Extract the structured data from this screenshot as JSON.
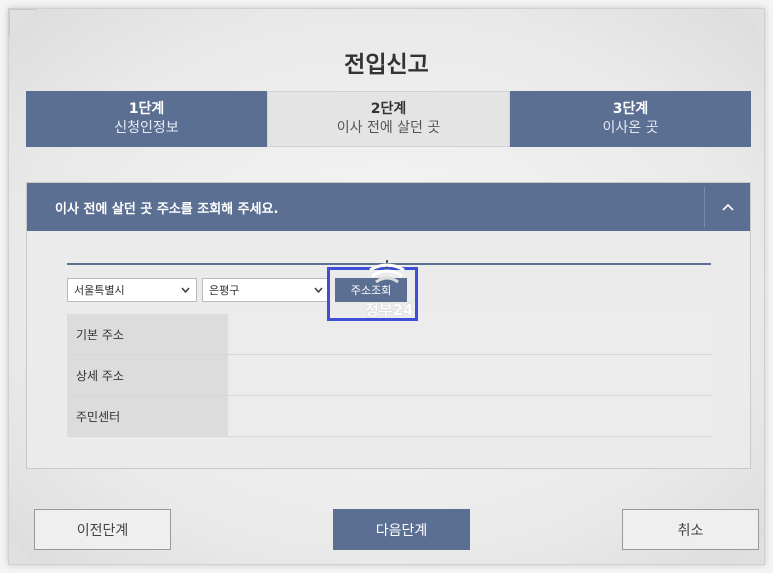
{
  "title": "전입신고",
  "steps": [
    {
      "num": "1단계",
      "label": "신청인정보"
    },
    {
      "num": "2단계",
      "label": "이사 전에 살던 곳"
    },
    {
      "num": "3단계",
      "label": "이사온 곳"
    }
  ],
  "panel": {
    "heading": "이사 전에 살던 곳 주소를 조회해 주세요.",
    "city_select": "서울특별시",
    "district_select": "은평구",
    "search_button": "주소조회",
    "rows": [
      {
        "label": "기본 주소",
        "value": ""
      },
      {
        "label": "상세 주소",
        "value": ""
      },
      {
        "label": "주민센터",
        "value": ""
      }
    ]
  },
  "overlay": {
    "logo_text": "정부24"
  },
  "footer": {
    "prev": "이전단계",
    "next": "다음단계",
    "cancel": "취소"
  },
  "colors": {
    "accent": "#5b6f93",
    "highlight_border": "#3d4fd8"
  }
}
